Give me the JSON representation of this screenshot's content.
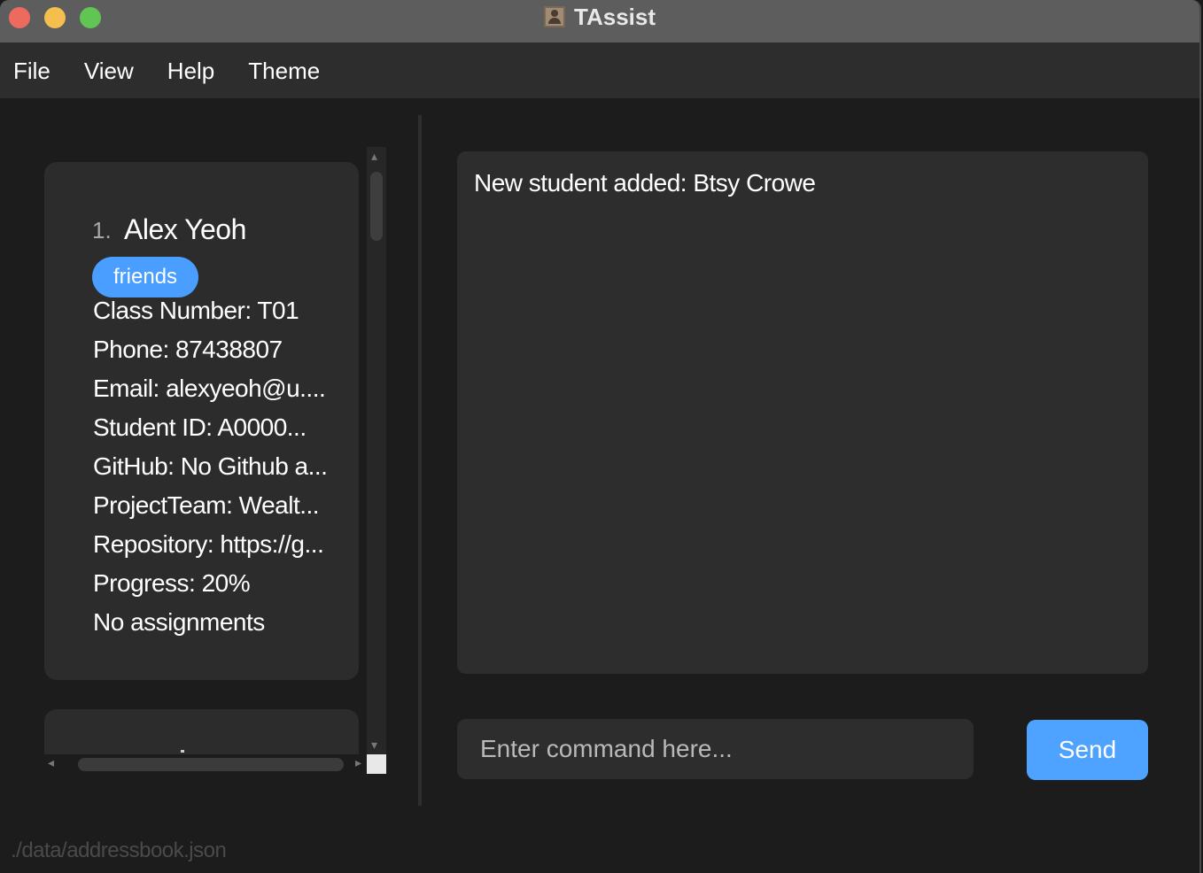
{
  "window": {
    "title": "TAssist"
  },
  "menu": [
    {
      "label": "File"
    },
    {
      "label": "View"
    },
    {
      "label": "Help"
    },
    {
      "label": "Theme"
    }
  ],
  "persons": [
    {
      "index": "1.",
      "name": "Alex Yeoh",
      "tags": [
        "friends"
      ],
      "fields": [
        "Class Number: T01",
        "Phone: 87438807",
        "Email: alexyeoh@u....",
        "Student ID: A0000...",
        "GitHub: No Github a...",
        "ProjectTeam: Wealt...",
        "Repository: https://g...",
        "Progress: 20%",
        "No assignments"
      ]
    }
  ],
  "result": {
    "message": "New student added: Btsy Crowe"
  },
  "command": {
    "placeholder": "Enter command here...",
    "value": ""
  },
  "send_button": {
    "label": "Send"
  },
  "status_bar": {
    "file_path": "./data/addressbook.json"
  },
  "colors": {
    "tag": "#4a9eff",
    "send_button": "#4da3ff",
    "panel": "#2d2d2d",
    "background": "#1c1c1c"
  }
}
